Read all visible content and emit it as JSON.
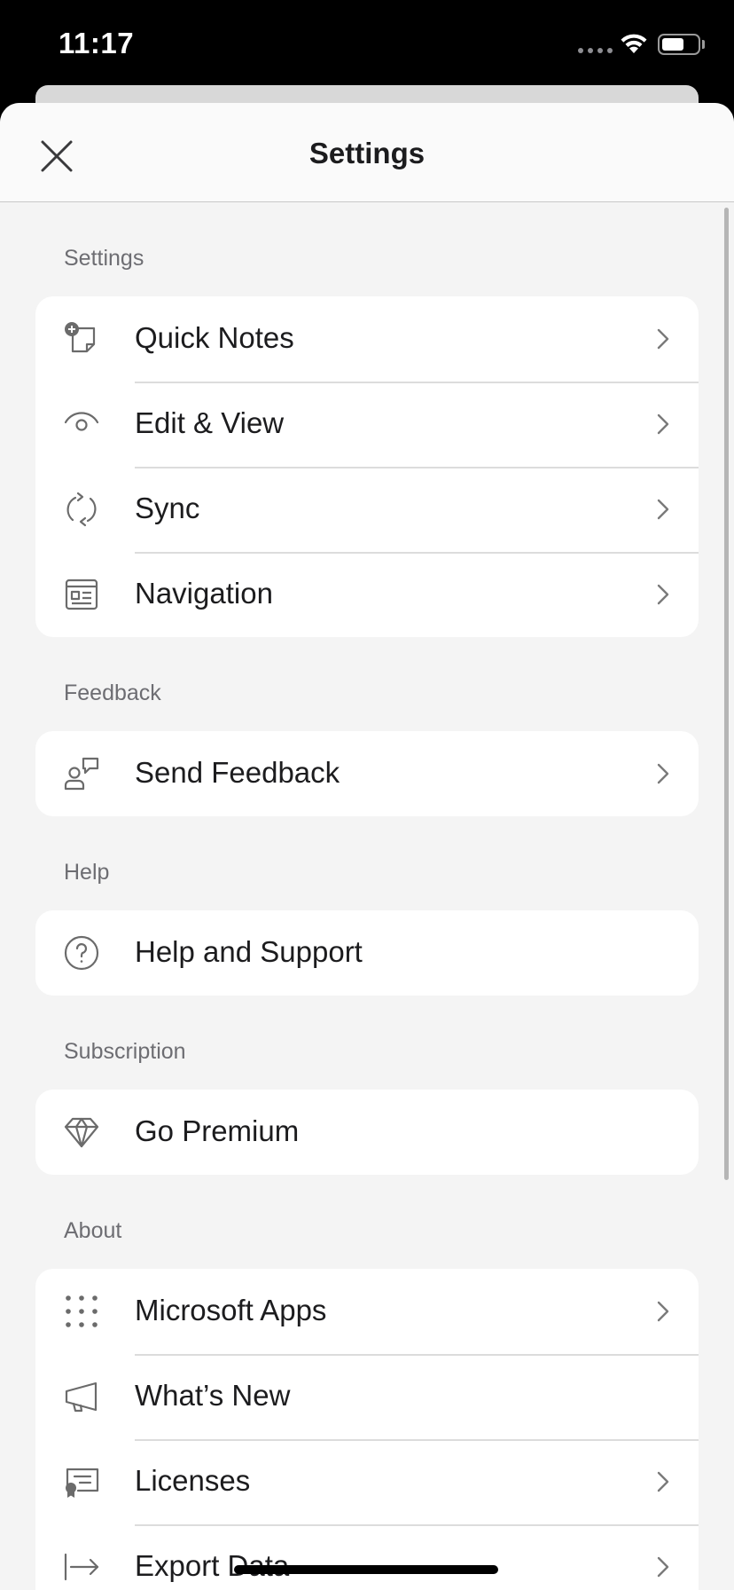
{
  "status_bar": {
    "time": "11:17"
  },
  "header": {
    "title": "Settings"
  },
  "sections": [
    {
      "label": "Settings",
      "items": [
        {
          "label": "Quick Notes",
          "icon": "quick-note-icon",
          "chevron": true
        },
        {
          "label": "Edit & View",
          "icon": "eye-icon",
          "chevron": true
        },
        {
          "label": "Sync",
          "icon": "sync-icon",
          "chevron": true
        },
        {
          "label": "Navigation",
          "icon": "navigation-layout-icon",
          "chevron": true
        }
      ]
    },
    {
      "label": "Feedback",
      "items": [
        {
          "label": "Send Feedback",
          "icon": "person-feedback-icon",
          "chevron": true
        }
      ]
    },
    {
      "label": "Help",
      "items": [
        {
          "label": "Help and Support",
          "icon": "question-circle-icon",
          "chevron": false
        }
      ]
    },
    {
      "label": "Subscription",
      "items": [
        {
          "label": "Go Premium",
          "icon": "diamond-icon",
          "chevron": false
        }
      ]
    },
    {
      "label": "About",
      "items": [
        {
          "label": "Microsoft Apps",
          "icon": "apps-grid-icon",
          "chevron": true
        },
        {
          "label": "What’s New",
          "icon": "megaphone-icon",
          "chevron": false
        },
        {
          "label": "Licenses",
          "icon": "certificate-icon",
          "chevron": true
        },
        {
          "label": "Export Data",
          "icon": "export-arrow-icon",
          "chevron": true
        }
      ]
    }
  ]
}
